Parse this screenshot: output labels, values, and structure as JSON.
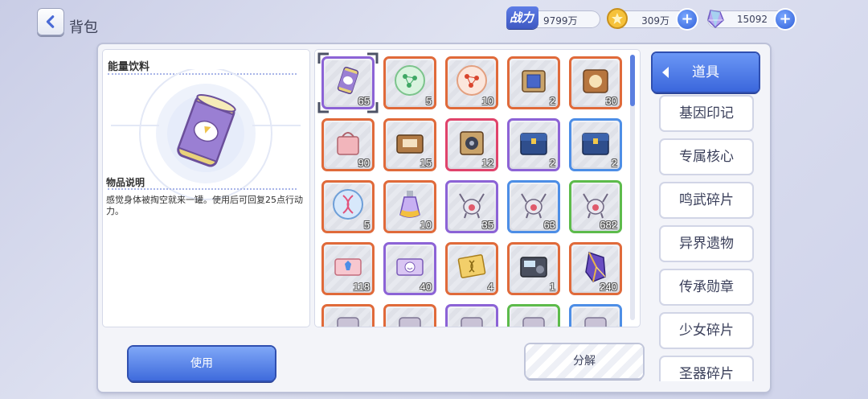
{
  "header": {
    "title": "背包",
    "power_label": "战力",
    "power_value": "9799万",
    "coin_value": "309万",
    "gem_value": "15092"
  },
  "detail": {
    "item_name": "能量饮料",
    "desc_title": "物品说明",
    "desc_text": "感觉身体被掏空就来一罐。使用后可回复25点行动力。"
  },
  "items": [
    {
      "count": "65",
      "rarity": "purple",
      "icon": "energy-drink-can-icon",
      "selected": true
    },
    {
      "count": "5",
      "rarity": "orange",
      "icon": "green-molecule-orb-icon"
    },
    {
      "count": "10",
      "rarity": "orange",
      "icon": "red-molecule-orb-icon"
    },
    {
      "count": "2",
      "rarity": "orange",
      "icon": "blue-cube-chest-icon"
    },
    {
      "count": "30",
      "rarity": "orange",
      "icon": "gold-box-icon"
    },
    {
      "count": "90",
      "rarity": "orange",
      "icon": "pink-gift-bag-icon"
    },
    {
      "count": "15",
      "rarity": "orange",
      "icon": "wooden-chest-icon"
    },
    {
      "count": "12",
      "rarity": "red",
      "icon": "mechanical-chest-icon"
    },
    {
      "count": "2",
      "rarity": "purple",
      "icon": "blue-treasure-chest-icon"
    },
    {
      "count": "2",
      "rarity": "blue",
      "icon": "blue-treasure-chest-icon"
    },
    {
      "count": "5",
      "rarity": "orange",
      "icon": "dna-orb-icon"
    },
    {
      "count": "10",
      "rarity": "orange",
      "icon": "potion-bottle-icon"
    },
    {
      "count": "35",
      "rarity": "purple",
      "icon": "crab-core-icon"
    },
    {
      "count": "63",
      "rarity": "blue",
      "icon": "crab-core-icon"
    },
    {
      "count": "682",
      "rarity": "green",
      "icon": "crab-core-icon"
    },
    {
      "count": "118",
      "rarity": "orange",
      "icon": "ticket-icon"
    },
    {
      "count": "40",
      "rarity": "purple",
      "icon": "smile-ticket-icon"
    },
    {
      "count": "4",
      "rarity": "orange",
      "icon": "dna-card-icon"
    },
    {
      "count": "1",
      "rarity": "orange",
      "icon": "radio-device-icon"
    },
    {
      "count": "240",
      "rarity": "orange",
      "icon": "crystal-shard-icon"
    },
    {
      "count": "",
      "rarity": "orange",
      "icon": "partial-item-icon"
    },
    {
      "count": "",
      "rarity": "orange",
      "icon": "partial-item-icon"
    },
    {
      "count": "",
      "rarity": "purple",
      "icon": "partial-item-icon"
    },
    {
      "count": "",
      "rarity": "green",
      "icon": "partial-item-icon"
    },
    {
      "count": "",
      "rarity": "blue",
      "icon": "partial-item-icon"
    }
  ],
  "tabs": [
    {
      "label": "道具",
      "active": true
    },
    {
      "label": "基因印记"
    },
    {
      "label": "专属核心"
    },
    {
      "label": "鸣武碎片"
    },
    {
      "label": "异界遗物"
    },
    {
      "label": "传承勋章"
    },
    {
      "label": "少女碎片"
    },
    {
      "label": "圣器碎片"
    }
  ],
  "buttons": {
    "use": "使用",
    "split": "分解"
  },
  "colors": {
    "orange": "#e06a3a",
    "purple": "#8c63d6",
    "blue": "#4d8ee6",
    "red": "#e0436b",
    "green": "#5dbb4b",
    "accent": "#3f6bdc"
  }
}
